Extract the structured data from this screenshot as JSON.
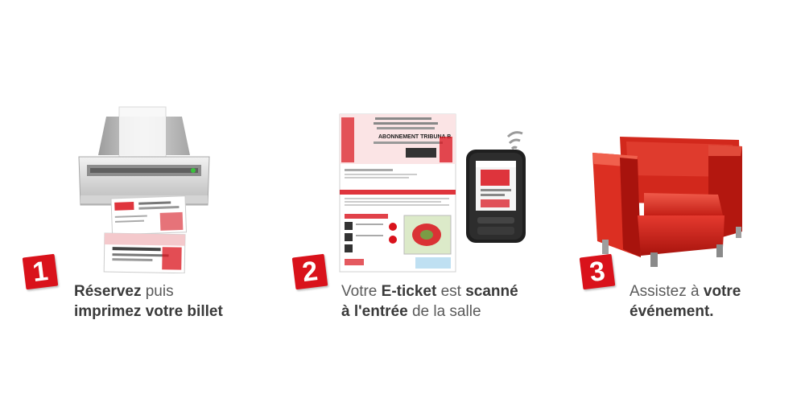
{
  "colors": {
    "accent": "#d9121b",
    "text": "#5a5a5a",
    "text_strong": "#3a3a3a"
  },
  "steps": [
    {
      "number": "1",
      "illustration": "printer-icon",
      "caption_line1_strong": "Réservez",
      "caption_line1_rest": " puis",
      "caption_line2_strong": "imprimez votre billet"
    },
    {
      "number": "2",
      "illustration": "e-ticket-and-scanner-icon",
      "caption_line1_pre": "Votre ",
      "caption_line1_strong1": "E-ticket",
      "caption_line1_mid": " est ",
      "caption_line1_strong2": "scanné",
      "caption_line2_strong": "à l'entrée",
      "caption_line2_rest": " de la salle",
      "ticket_title": "ABONNEMENT TRIBUNA B"
    },
    {
      "number": "3",
      "illustration": "armchair-icon",
      "caption_line1_pre": "Assistez à ",
      "caption_line1_strong": "votre",
      "caption_line2_strong": "événement."
    }
  ]
}
